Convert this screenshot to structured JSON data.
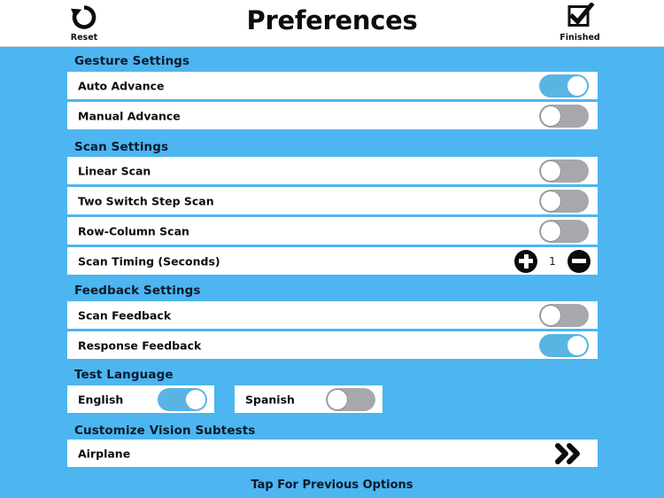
{
  "header": {
    "title": "Preferences",
    "reset_label": "Reset",
    "reset_icon": "undo-circular-arrow-icon",
    "finished_label": "Finished",
    "finished_icon": "checkbox-check-icon"
  },
  "colors": {
    "background": "#4db5f0",
    "toggle_on": "#5ab4e3",
    "toggle_off": "#a6a8ab",
    "row_background": "#ffffff",
    "section_title": "#0a1b2b",
    "header_background": "#ffffff"
  },
  "sections": [
    {
      "title": "Gesture Settings",
      "rows": [
        {
          "label": "Auto Advance",
          "control": "toggle",
          "state": "on"
        },
        {
          "label": "Manual Advance",
          "control": "toggle",
          "state": "off"
        }
      ]
    },
    {
      "title": "Scan Settings",
      "rows": [
        {
          "label": "Linear Scan",
          "control": "toggle",
          "state": "off"
        },
        {
          "label": "Two Switch Step Scan",
          "control": "toggle",
          "state": "off"
        },
        {
          "label": "Row-Column Scan",
          "control": "toggle",
          "state": "off"
        },
        {
          "label": "Scan Timing (Seconds)",
          "control": "stepper",
          "value": "1",
          "increment_icon": "plus-circle-icon",
          "decrement_icon": "minus-circle-icon"
        }
      ]
    },
    {
      "title": "Feedback Settings",
      "rows": [
        {
          "label": "Scan Feedback",
          "control": "toggle",
          "state": "off"
        },
        {
          "label": "Response Feedback",
          "control": "toggle",
          "state": "on"
        }
      ]
    },
    {
      "title": "Test Language",
      "rows": [
        {
          "label": "English",
          "control": "toggle",
          "state": "on"
        },
        {
          "label": "Spanish",
          "control": "toggle",
          "state": "off"
        }
      ]
    },
    {
      "title": "Customize Vision Subtests",
      "rows": [
        {
          "label": "Airplane",
          "control": "chevron",
          "chevron_icon": "double-chevron-right-icon"
        }
      ]
    }
  ],
  "footer": {
    "text": "Tap For Previous Options"
  }
}
